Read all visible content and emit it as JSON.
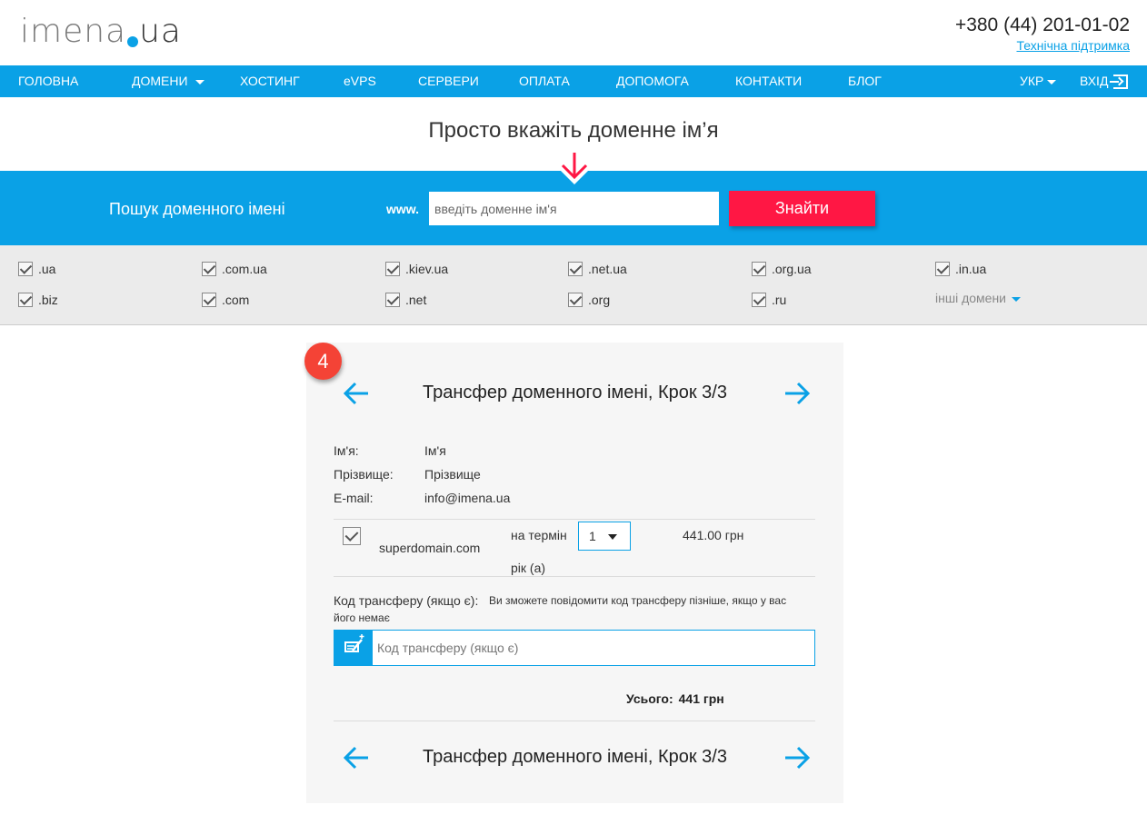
{
  "header": {
    "logo_main": "imena",
    "logo_tld": "ua",
    "phone": "+380 (44) 201-01-02",
    "support_link": "Технічна підтримка"
  },
  "nav": {
    "items": [
      "Головна",
      "Домени",
      "Хостинг",
      "eVPS",
      "Сервери",
      "Оплата",
      "Допомога",
      "Контакти",
      "Блог"
    ],
    "language": "УКР",
    "login": "Вхід"
  },
  "hero": {
    "title": "Просто вкажіть доменне ім’я"
  },
  "search": {
    "label": "Пошук доменного імені",
    "prefix": "www.",
    "placeholder": "введіть доменне ім'я",
    "button": "Знайти"
  },
  "tlds": {
    "row1": [
      ".ua",
      ".com.ua",
      ".kiev.ua",
      ".net.ua",
      ".org.ua",
      ".in.ua"
    ],
    "row2": [
      ".biz",
      ".com",
      ".net",
      ".org",
      ".ru"
    ],
    "other": "інші домени"
  },
  "panel": {
    "step_badge": "4",
    "step_title": "Трансфер доменного імені, Крок 3/3",
    "contact": {
      "first_name_label": "Ім'я:",
      "first_name_value": "Ім'я",
      "last_name_label": "Прізвище:",
      "last_name_value": "Прізвище",
      "email_label": "E-mail:",
      "email_value": "info@imena.ua"
    },
    "order": {
      "domain": "superdomain.com",
      "term_label": "на термін",
      "term_unit": "рік (а)",
      "term_value": "1",
      "price": "441.00 грн"
    },
    "transfer": {
      "label": "Код трансферу (якщо є):",
      "hint_line1": "Ви зможете повідомити код трансферу пізніше, якщо у вас",
      "hint_line2": "його немає",
      "placeholder": "Код трансферу (якщо є)"
    },
    "total": {
      "label": "Усього:",
      "value": "441 грн"
    }
  },
  "colors": {
    "brand_blue": "#0aa1e6",
    "accent_red": "#ff1744",
    "badge_red": "#f44336"
  }
}
